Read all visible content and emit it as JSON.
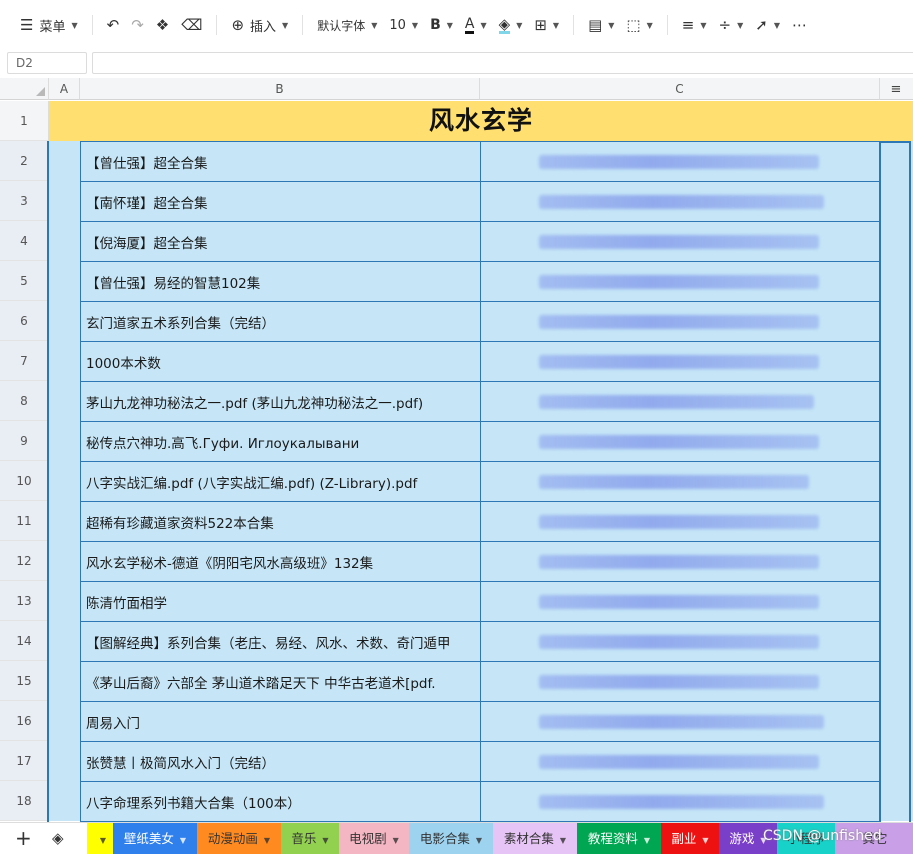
{
  "toolbar": {
    "menu_label": "菜单",
    "insert_label": "插入",
    "font_label": "默认字体",
    "font_size": "10",
    "bold_label": "B",
    "font_color_label": "A"
  },
  "namebox": {
    "value": "D2"
  },
  "columns": [
    "A",
    "B",
    "C"
  ],
  "title": {
    "row": "1",
    "text": "风水玄学"
  },
  "rows": [
    {
      "num": "2",
      "text": "【曾仕强】超全合集",
      "blur": 280
    },
    {
      "num": "3",
      "text": "【南怀瑾】超全合集",
      "blur": 285
    },
    {
      "num": "4",
      "text": "【倪海厦】超全合集",
      "blur": 280
    },
    {
      "num": "5",
      "text": "【曾仕强】易经的智慧102集",
      "blur": 280
    },
    {
      "num": "6",
      "text": "玄门道家五术系列合集（完结）",
      "blur": 280
    },
    {
      "num": "7",
      "text": "1000本术数",
      "blur": 280
    },
    {
      "num": "8",
      "text": "茅山九龙神功秘法之一.pdf (茅山九龙神功秘法之一.pdf)",
      "blur": 275
    },
    {
      "num": "9",
      "text": "秘传点穴神功.高飞.Гуфи. Иглоукалывани",
      "blur": 280
    },
    {
      "num": "10",
      "text": "八字实战汇编.pdf (八字实战汇编.pdf) (Z-Library).pdf",
      "blur": 270
    },
    {
      "num": "11",
      "text": "超稀有珍藏道家资料522本合集",
      "blur": 280
    },
    {
      "num": "12",
      "text": "风水玄学秘术-德道《阴阳宅风水高级班》132集",
      "blur": 280
    },
    {
      "num": "13",
      "text": "陈清竹面相学",
      "blur": 280
    },
    {
      "num": "14",
      "text": "【图解经典】系列合集（老庄、易经、风水、术数、奇门遁甲",
      "blur": 280
    },
    {
      "num": "15",
      "text": "《茅山后裔》六部全 茅山道术踏足天下 中华古老道术[pdf.",
      "blur": 280
    },
    {
      "num": "16",
      "text": "周易入门",
      "blur": 285
    },
    {
      "num": "17",
      "text": "张赞慧丨极简风水入门（完结）",
      "blur": 280
    },
    {
      "num": "18",
      "text": "八字命理系列书籍大合集（100本）",
      "blur": 285
    }
  ],
  "tabs": [
    {
      "label": "",
      "bg": "#ffff00",
      "fg": "#333333",
      "caret": true,
      "w": 26
    },
    {
      "label": "壁纸美女",
      "bg": "#2f80ed",
      "fg": "#ffffff",
      "caret": true,
      "w": 84
    },
    {
      "label": "动漫动画",
      "bg": "#ff8a1f",
      "fg": "#333333",
      "caret": true,
      "w": 84
    },
    {
      "label": "音乐",
      "bg": "#92d050",
      "fg": "#333333",
      "caret": true,
      "w": 58
    },
    {
      "label": "电视剧",
      "bg": "#f4b6c2",
      "fg": "#333333",
      "caret": true,
      "w": 70
    },
    {
      "label": "电影合集",
      "bg": "#9dd3ef",
      "fg": "#333333",
      "caret": true,
      "w": 84
    },
    {
      "label": "素材合集",
      "bg": "#e6c4f5",
      "fg": "#333333",
      "caret": true,
      "w": 84
    },
    {
      "label": "教程资料",
      "bg": "#00a651",
      "fg": "#ffffff",
      "caret": true,
      "w": 84
    },
    {
      "label": "副业",
      "bg": "#ee1111",
      "fg": "#ffffff",
      "caret": true,
      "w": 58
    },
    {
      "label": "游戏",
      "bg": "#7a3fc9",
      "fg": "#ffffff",
      "caret": true,
      "w": 58
    },
    {
      "label": "小程序",
      "bg": "#17d2c8",
      "fg": "#333333",
      "caret": false,
      "w": 58
    },
    {
      "label": "其它",
      "bg": "#c9a0e8",
      "fg": "#333333",
      "caret": false,
      "w": 80
    }
  ],
  "watermark": "CSDN @unfished",
  "colors": {
    "cell_bg": "#c6e6f7",
    "title_bg": "#ffdf6f",
    "border": "#2d78b4"
  }
}
